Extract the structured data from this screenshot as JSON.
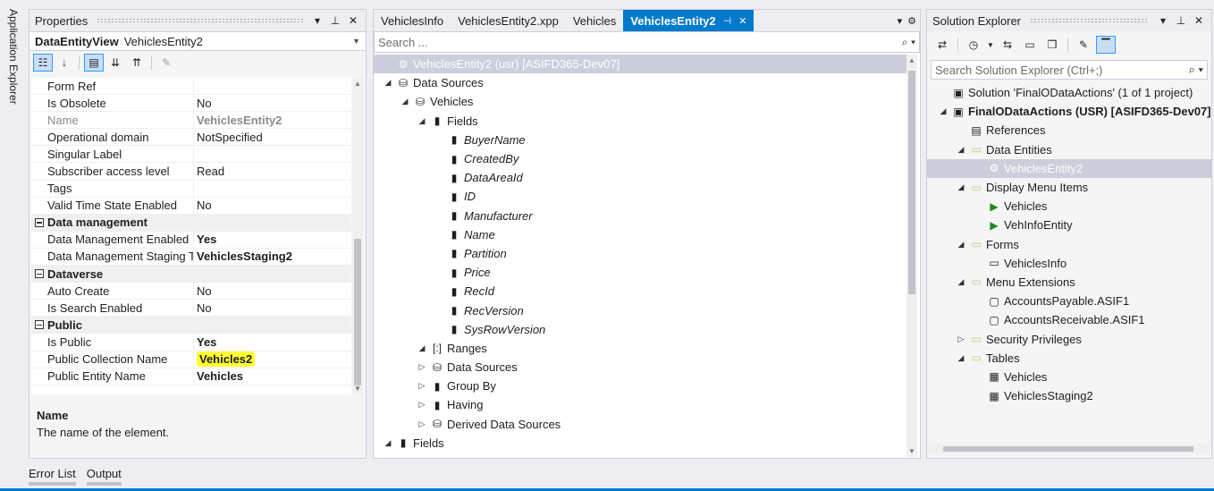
{
  "left_strip": {
    "label": "Application Explorer"
  },
  "properties": {
    "title": "Properties",
    "object_type": "DataEntityView",
    "object_name": "VehiclesEntity2",
    "rows": [
      {
        "kind": "prop",
        "name": "Form Ref",
        "value": ""
      },
      {
        "kind": "prop",
        "name": "Is Obsolete",
        "value": "No"
      },
      {
        "kind": "prop",
        "name": "Name",
        "value": "VehiclesEntity2",
        "dim": true,
        "bold": true
      },
      {
        "kind": "prop",
        "name": "Operational domain",
        "value": "NotSpecified"
      },
      {
        "kind": "prop",
        "name": "Singular Label",
        "value": ""
      },
      {
        "kind": "prop",
        "name": "Subscriber access level",
        "value": "Read"
      },
      {
        "kind": "prop",
        "name": "Tags",
        "value": ""
      },
      {
        "kind": "prop",
        "name": "Valid Time State Enabled",
        "value": "No"
      },
      {
        "kind": "cat",
        "name": "Data management"
      },
      {
        "kind": "prop",
        "name": "Data Management Enabled",
        "value": "Yes",
        "bold": true
      },
      {
        "kind": "prop",
        "name": "Data Management Staging Table",
        "value": "VehiclesStaging2",
        "bold": true
      },
      {
        "kind": "cat",
        "name": "Dataverse"
      },
      {
        "kind": "prop",
        "name": "Auto Create",
        "value": "No"
      },
      {
        "kind": "prop",
        "name": "Is Search Enabled",
        "value": "No"
      },
      {
        "kind": "cat",
        "name": "Public"
      },
      {
        "kind": "prop",
        "name": "Is Public",
        "value": "Yes",
        "bold": true
      },
      {
        "kind": "prop",
        "name": "Public Collection Name",
        "value": "Vehicles2",
        "bold": true,
        "highlight": true
      },
      {
        "kind": "prop",
        "name": "Public Entity Name",
        "value": "Vehicles",
        "bold": true
      }
    ],
    "description": {
      "title": "Name",
      "text": "The name of the element."
    }
  },
  "editor": {
    "tabs": [
      {
        "label": "VehiclesInfo",
        "active": false
      },
      {
        "label": "VehiclesEntity2.xpp",
        "active": false
      },
      {
        "label": "Vehicles",
        "active": false
      },
      {
        "label": "VehiclesEntity2",
        "active": true
      }
    ],
    "search_placeholder": "Search ...",
    "tree": [
      {
        "level": 0,
        "exp": "",
        "icon": "entity-icon",
        "glyph": "⚙",
        "label": "VehiclesEntity2 (usr) [ASIFD365-Dev07]",
        "sel": true
      },
      {
        "level": 0,
        "exp": "◢",
        "icon": "datasource-icon",
        "glyph": "⛁",
        "label": "Data Sources"
      },
      {
        "level": 1,
        "exp": "◢",
        "icon": "datasource-icon",
        "glyph": "⛁",
        "label": "Vehicles"
      },
      {
        "level": 2,
        "exp": "◢",
        "icon": "field-icon",
        "glyph": "▮",
        "label": "Fields"
      },
      {
        "level": 3,
        "exp": "",
        "icon": "field-icon",
        "glyph": "▮",
        "label": "BuyerName",
        "italic": true
      },
      {
        "level": 3,
        "exp": "",
        "icon": "field-icon",
        "glyph": "▮",
        "label": "CreatedBy",
        "italic": true
      },
      {
        "level": 3,
        "exp": "",
        "icon": "field-icon",
        "glyph": "▮",
        "label": "DataAreaId",
        "italic": true
      },
      {
        "level": 3,
        "exp": "",
        "icon": "field-icon",
        "glyph": "▮",
        "label": "ID",
        "italic": true
      },
      {
        "level": 3,
        "exp": "",
        "icon": "field-icon",
        "glyph": "▮",
        "label": "Manufacturer",
        "italic": true
      },
      {
        "level": 3,
        "exp": "",
        "icon": "field-icon",
        "glyph": "▮",
        "label": "Name",
        "italic": true
      },
      {
        "level": 3,
        "exp": "",
        "icon": "field-icon",
        "glyph": "▮",
        "label": "Partition",
        "italic": true
      },
      {
        "level": 3,
        "exp": "",
        "icon": "field-icon",
        "glyph": "▮",
        "label": "Price",
        "italic": true
      },
      {
        "level": 3,
        "exp": "",
        "icon": "field-icon",
        "glyph": "▮",
        "label": "RecId",
        "italic": true
      },
      {
        "level": 3,
        "exp": "",
        "icon": "field-icon",
        "glyph": "▮",
        "label": "RecVersion",
        "italic": true
      },
      {
        "level": 3,
        "exp": "",
        "icon": "field-icon",
        "glyph": "▮",
        "label": "SysRowVersion",
        "italic": true
      },
      {
        "level": 2,
        "exp": "◢",
        "icon": "ranges-icon",
        "glyph": "[:]",
        "label": "Ranges"
      },
      {
        "level": 2,
        "exp": "▷",
        "icon": "datasource-icon",
        "glyph": "⛁",
        "label": "Data Sources"
      },
      {
        "level": 2,
        "exp": "▷",
        "icon": "field-icon",
        "glyph": "▮",
        "label": "Group By"
      },
      {
        "level": 2,
        "exp": "▷",
        "icon": "field-icon",
        "glyph": "▮",
        "label": "Having"
      },
      {
        "level": 2,
        "exp": "▷",
        "icon": "datasource-icon",
        "glyph": "⛁",
        "label": "Derived Data Sources"
      },
      {
        "level": 0,
        "exp": "◢",
        "icon": "field-icon",
        "glyph": "▮",
        "label": "Fields"
      }
    ]
  },
  "solution_explorer": {
    "title": "Solution Explorer",
    "search_placeholder": "Search Solution Explorer (Ctrl+;)",
    "tree": [
      {
        "level": 0,
        "exp": "",
        "icon": "solution-icon",
        "glyph": "▣",
        "label": "Solution 'FinalODataActions' (1 of 1 project)"
      },
      {
        "level": 0,
        "exp": "◢",
        "icon": "project-icon",
        "glyph": "▣",
        "label": "FinalODataActions (USR) [ASIFD365-Dev07]",
        "bold": true
      },
      {
        "level": 1,
        "exp": "",
        "icon": "references-icon",
        "glyph": "▤",
        "label": "References"
      },
      {
        "level": 1,
        "exp": "◢",
        "icon": "folder-icon",
        "glyph": "▭",
        "label": "Data Entities"
      },
      {
        "level": 2,
        "exp": "",
        "icon": "entity-icon",
        "glyph": "⚙",
        "label": "VehiclesEntity2",
        "sel": true
      },
      {
        "level": 1,
        "exp": "◢",
        "icon": "folder-icon",
        "glyph": "▭",
        "label": "Display Menu Items"
      },
      {
        "level": 2,
        "exp": "",
        "icon": "menuitem-icon",
        "glyph": "▶",
        "label": "Vehicles"
      },
      {
        "level": 2,
        "exp": "",
        "icon": "menuitem-icon",
        "glyph": "▶",
        "label": "VehInfoEntity"
      },
      {
        "level": 1,
        "exp": "◢",
        "icon": "folder-icon",
        "glyph": "▭",
        "label": "Forms"
      },
      {
        "level": 2,
        "exp": "",
        "icon": "form-icon",
        "glyph": "▭",
        "label": "VehiclesInfo"
      },
      {
        "level": 1,
        "exp": "◢",
        "icon": "folder-icon",
        "glyph": "▭",
        "label": "Menu Extensions"
      },
      {
        "level": 2,
        "exp": "",
        "icon": "extension-icon",
        "glyph": "▢",
        "label": "AccountsPayable.ASIF1"
      },
      {
        "level": 2,
        "exp": "",
        "icon": "extension-icon",
        "glyph": "▢",
        "label": "AccountsReceivable.ASIF1"
      },
      {
        "level": 1,
        "exp": "▷",
        "icon": "folder-icon",
        "glyph": "▭",
        "label": "Security Privileges"
      },
      {
        "level": 1,
        "exp": "◢",
        "icon": "folder-icon",
        "glyph": "▭",
        "label": "Tables"
      },
      {
        "level": 2,
        "exp": "",
        "icon": "table-icon",
        "glyph": "▦",
        "label": "Vehicles"
      },
      {
        "level": 2,
        "exp": "",
        "icon": "table-icon",
        "glyph": "▦",
        "label": "VehiclesStaging2"
      }
    ]
  },
  "bottom_tabs": [
    "Error List",
    "Output"
  ],
  "colors": {
    "accent": "#007acc",
    "selection": "#0078d7",
    "highlight": "#ffff33",
    "folder": "#dcb67a"
  }
}
